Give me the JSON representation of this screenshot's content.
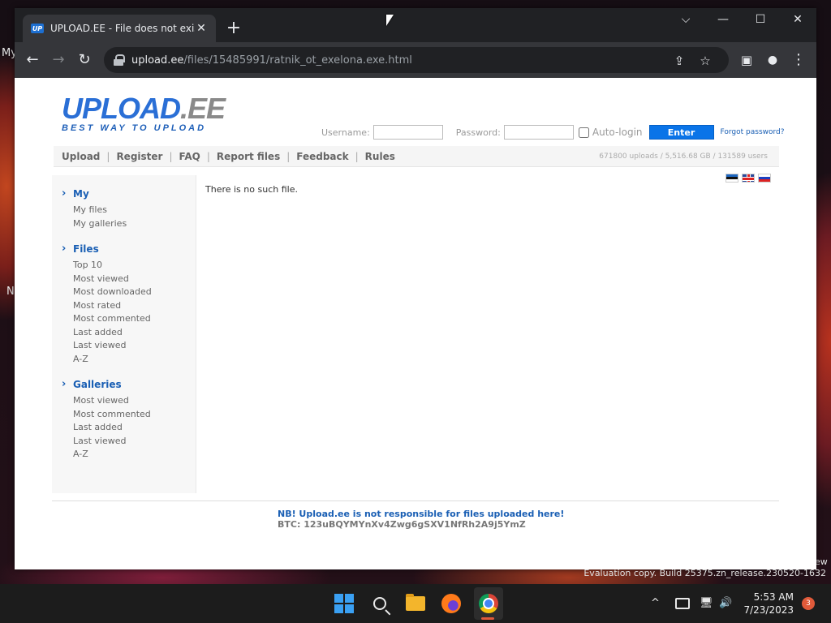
{
  "desktop": {
    "left_labels": [
      "My",
      "N"
    ],
    "right_label": "ew",
    "eval_text": "Evaluation copy. Build 25375.zn_release.230520-1632"
  },
  "browser": {
    "tab": {
      "favicon_text": "UP",
      "title": "UPLOAD.EE - File does not exist",
      "close": "✕"
    },
    "newtab": "+",
    "window_controls": {
      "tabsearch": "⌵",
      "minimize": "—",
      "maximize": "☐",
      "close": "✕"
    },
    "nav": {
      "back": "←",
      "forward": "→",
      "reload": "↻"
    },
    "url": {
      "host": "upload.ee",
      "path": "/files/15485991/ratnik_ot_exelona.exe.html"
    },
    "omni_icons": {
      "share": "⇪",
      "bookmark": "☆",
      "sidepanel": "▣",
      "profile": "●",
      "menu": "⋮"
    }
  },
  "site": {
    "logo": {
      "main_a": "UPLOAD",
      "main_b": ".EE",
      "tagline": "BEST WAY TO UPLOAD"
    },
    "login": {
      "username_label": "Username:",
      "username_value": "",
      "password_label": "Password:",
      "password_value": "",
      "autologin_label": "Auto-login",
      "autologin_checked": false,
      "enter_label": "Enter",
      "forgot_label": "Forgot password?"
    },
    "menu": [
      {
        "label": "Upload"
      },
      {
        "label": "Register"
      },
      {
        "label": "FAQ"
      },
      {
        "label": "Report files"
      },
      {
        "label": "Feedback"
      },
      {
        "label": "Rules"
      }
    ],
    "stats": "671800 uploads  /  5,516.68 GB  /  131589 users",
    "languages": [
      "flag-estonia",
      "flag-uk",
      "flag-russia"
    ],
    "sidebar": [
      {
        "title": "My",
        "links": [
          "My files",
          "My galleries"
        ]
      },
      {
        "title": "Files",
        "links": [
          "Top 10",
          "Most viewed",
          "Most downloaded",
          "Most rated",
          "Most commented",
          "Last added",
          "Last viewed",
          "A-Z"
        ]
      },
      {
        "title": "Galleries",
        "links": [
          "Most viewed",
          "Most commented",
          "Last added",
          "Last viewed",
          "A-Z"
        ]
      }
    ],
    "message": "There is no such file.",
    "footer": {
      "warning": "NB! Upload.ee is not responsible for files uploaded here!",
      "btc": "BTC: 123uBQYMYnXv4Zwg6gSXV1NfRh2A9j5YmZ"
    }
  },
  "taskbar": {
    "apps": [
      "start-icon",
      "search-icon",
      "file-explorer-icon",
      "firefox-icon",
      "chrome-icon"
    ],
    "tray": {
      "chevron": "^",
      "network": "🖥",
      "volume": "🔊"
    },
    "time": "5:53 AM",
    "date": "7/23/2023",
    "notifications": "3"
  }
}
